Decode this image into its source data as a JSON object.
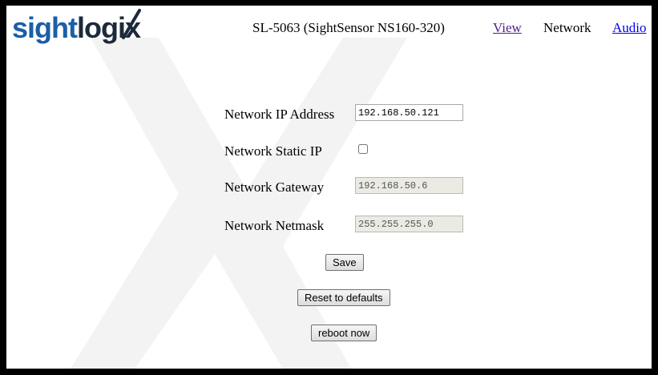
{
  "header": {
    "logo_sight": "sight",
    "logo_logix": "logix",
    "device_title": "SL-5063 (SightSensor NS160-320)",
    "nav": {
      "view": "View",
      "network": "Network",
      "audio": "Audio"
    }
  },
  "form": {
    "ip_address_label": "Network IP Address",
    "ip_address_value": "192.168.50.121",
    "static_ip_label": "Network Static IP",
    "static_ip_checked": false,
    "gateway_label": "Network Gateway",
    "gateway_value": "192.168.50.6",
    "netmask_label": "Network Netmask",
    "netmask_value": "255.255.255.0"
  },
  "buttons": {
    "save": "Save",
    "reset": "Reset to defaults",
    "reboot": "reboot now"
  },
  "colors": {
    "brand_blue": "#1a5ea8",
    "brand_dark": "#1c2a3a",
    "link_visited": "#551a8b",
    "link": "#0000ee"
  }
}
